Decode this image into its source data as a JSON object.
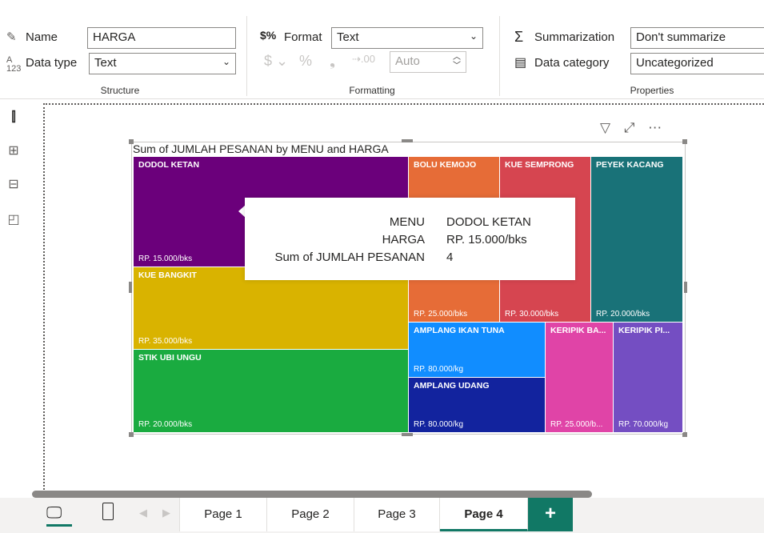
{
  "ribbon": {
    "structure": {
      "name_label": "Name",
      "name_value": "HARGA",
      "datatype_label": "Data type",
      "datatype_value": "Text",
      "group_label": "Structure"
    },
    "formatting": {
      "format_label": "Format",
      "format_value": "Text",
      "auto_value": "Auto",
      "group_label": "Formatting"
    },
    "properties": {
      "summarization_label": "Summarization",
      "summarization_value": "Don't summarize",
      "category_label": "Data category",
      "category_value": "Uncategorized",
      "group_label": "Properties"
    }
  },
  "visual": {
    "title": "Sum of JUMLAH PESANAN by MENU and HARGA",
    "tiles": [
      {
        "menu": "DODOL KETAN",
        "harga": "RP. 15.000/bks",
        "color": "#6b007b"
      },
      {
        "menu": "KUE BANGKIT",
        "harga": "RP. 35.000/bks",
        "color": "#d9b300"
      },
      {
        "menu": "STIK UBI UNGU",
        "harga": "RP. 20.000/bks",
        "color": "#1aab40"
      },
      {
        "menu": "BOLU KEMOJO",
        "harga": "RP. 25.000/bks",
        "color": "#e66c37"
      },
      {
        "menu": "KUE SEMPRONG",
        "harga": "RP. 30.000/bks",
        "color": "#d64550"
      },
      {
        "menu": "PEYEK KACANG",
        "harga": "RP. 20.000/bks",
        "color": "#197278"
      },
      {
        "menu": "AMPLANG IKAN TUNA",
        "harga": "RP. 80.000/kg",
        "color": "#118dff"
      },
      {
        "menu": "AMPLANG UDANG",
        "harga": "RP. 80.000/kg",
        "color": "#12239e"
      },
      {
        "menu": "KERIPIK BA...",
        "harga": "RP. 25.000/b...",
        "color": "#e044a7"
      },
      {
        "menu": "KERIPIK PI...",
        "harga": "RP. 70.000/kg",
        "color": "#744ec2"
      }
    ],
    "tooltip": {
      "rows": [
        {
          "label": "MENU",
          "value": "DODOL KETAN"
        },
        {
          "label": "HARGA",
          "value": "RP. 15.000/bks"
        },
        {
          "label": "Sum of JUMLAH PESANAN",
          "value": "4"
        }
      ]
    }
  },
  "chart_data": {
    "type": "treemap",
    "title": "Sum of JUMLAH PESANAN by MENU and HARGA",
    "categories": [
      "DODOL KETAN",
      "KUE BANGKIT",
      "STIK UBI UNGU",
      "BOLU KEMOJO",
      "KUE SEMPRONG",
      "PEYEK KACANG",
      "AMPLANG IKAN TUNA",
      "AMPLANG UDANG",
      "KERIPIK BA...",
      "KERIPIK PI..."
    ],
    "values": [
      4,
      3,
      3,
      2,
      2,
      2,
      1,
      1,
      1,
      1
    ]
  },
  "pages": {
    "tabs": [
      "Page 1",
      "Page 2",
      "Page 3",
      "Page 4"
    ],
    "active": "Page 4",
    "add_label": "+"
  }
}
